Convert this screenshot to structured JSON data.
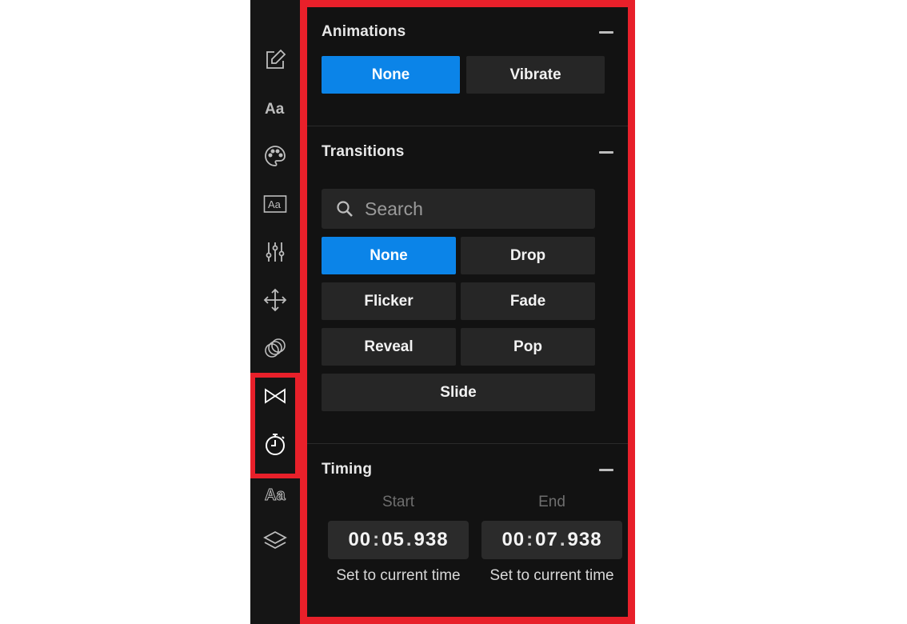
{
  "rail": {
    "icons": [
      "edit-icon",
      "text-style-icon",
      "palette-icon",
      "text-box-icon",
      "sliders-icon",
      "move-icon",
      "blend-icon",
      "transition-icon",
      "timer-icon",
      "outline-text-icon",
      "layers-icon"
    ]
  },
  "animations": {
    "title": "Animations",
    "options": [
      "None",
      "Vibrate"
    ],
    "selected": "None"
  },
  "transitions": {
    "title": "Transitions",
    "search_placeholder": "Search",
    "options": [
      "None",
      "Drop",
      "Flicker",
      "Fade",
      "Reveal",
      "Pop",
      "Slide"
    ],
    "selected": "None"
  },
  "timing": {
    "title": "Timing",
    "start": {
      "label": "Start",
      "mm": "00",
      "ss": "05",
      "ms": "938",
      "action": "Set to current time"
    },
    "end": {
      "label": "End",
      "mm": "00",
      "ss": "07",
      "ms": "938",
      "action": "Set to current time"
    }
  },
  "colors": {
    "accent": "#0b84e8",
    "highlight": "#e8202a",
    "panel_bg": "#121212",
    "button_bg": "#262626"
  }
}
